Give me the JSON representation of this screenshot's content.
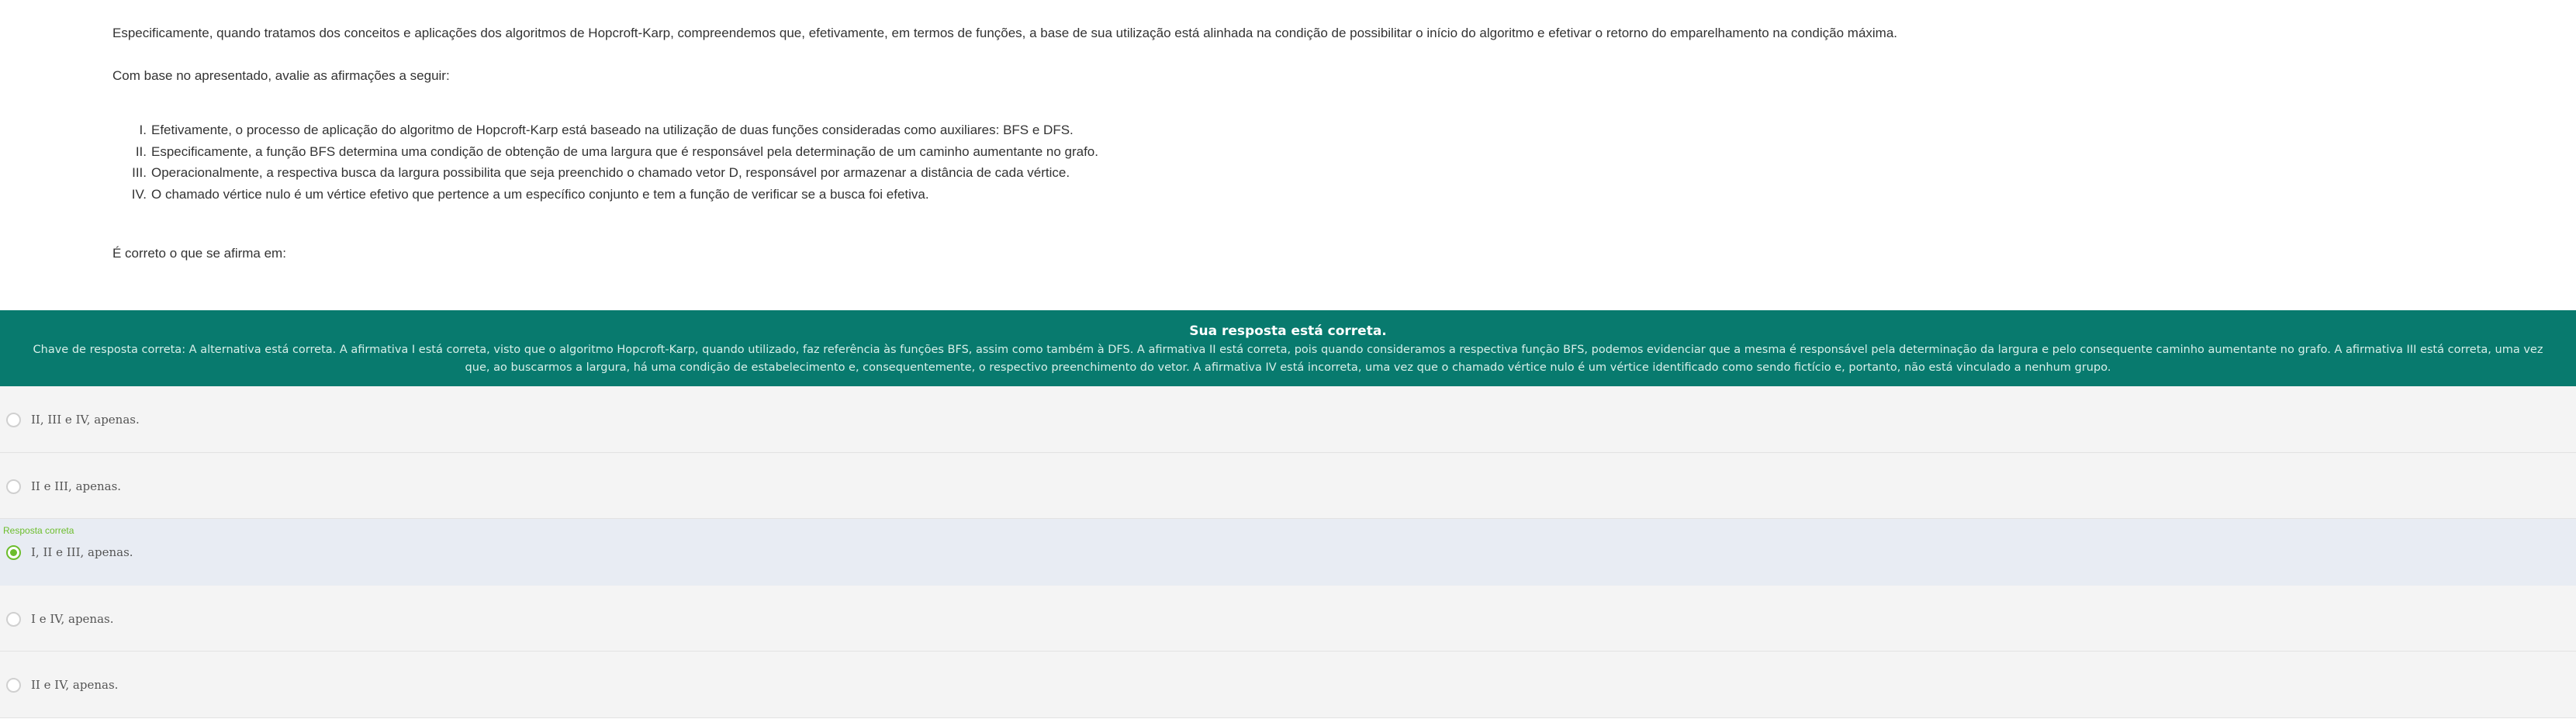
{
  "question": {
    "intro": "Especificamente, quando tratamos dos conceitos e aplicações dos algoritmos de Hopcroft-Karp, compreendemos que, efetivamente, em termos de funções, a base de sua utilização está alinhada na condição de possibilitar o início do algoritmo e efetivar o retorno do emparelhamento na condição máxima.",
    "prompt": "Com base no apresentado, avalie as afirmações a seguir:",
    "statements": [
      {
        "num": "I.",
        "text": "Efetivamente, o processo de aplicação do algoritmo de Hopcroft-Karp está baseado na utilização de duas funções consideradas como auxiliares: BFS e DFS."
      },
      {
        "num": "II.",
        "text": "Especificamente, a função BFS determina uma condição de obtenção de uma largura que é responsável pela determinação de um caminho aumentante no grafo."
      },
      {
        "num": "III.",
        "text": "Operacionalmente, a respectiva busca da largura possibilita que seja preenchido o chamado vetor D, responsável por armazenar a distância de cada vértice."
      },
      {
        "num": "IV.",
        "text": "O chamado vértice nulo é um vértice efetivo que pertence a um específico conjunto e tem a função de verificar se a busca foi efetiva."
      }
    ],
    "ask": "É correto o que se afirma em:"
  },
  "feedback": {
    "title": "Sua resposta está correta.",
    "text": "Chave de resposta correta: A alternativa está correta. A afirmativa I está correta, visto que o algoritmo Hopcroft-Karp, quando utilizado, faz referência às funções BFS, assim como também à DFS. A afirmativa II está correta, pois quando consideramos a respectiva função BFS, podemos evidenciar que a mesma é responsável pela determinação da largura e pelo consequente caminho aumentante no grafo. A afirmativa III está correta, uma vez que, ao buscarmos a largura, há uma condição de estabelecimento e, consequentemente, o respectivo preenchimento do vetor. A afirmativa IV está incorreta, uma vez que o chamado vértice nulo é um vértice identificado como sendo fictício e, portanto, não está vinculado a nenhum grupo.",
    "background_color": "#087a6e"
  },
  "options": [
    {
      "label": "II, III e IV, apenas."
    },
    {
      "label": "II e III, apenas."
    },
    {
      "label": "I, II e III, apenas.",
      "tag": "Resposta correta"
    },
    {
      "label": "I e IV, apenas."
    },
    {
      "label": "II e IV, apenas."
    }
  ],
  "selected_option_index": 2,
  "accent_color": "#6cbd2c"
}
